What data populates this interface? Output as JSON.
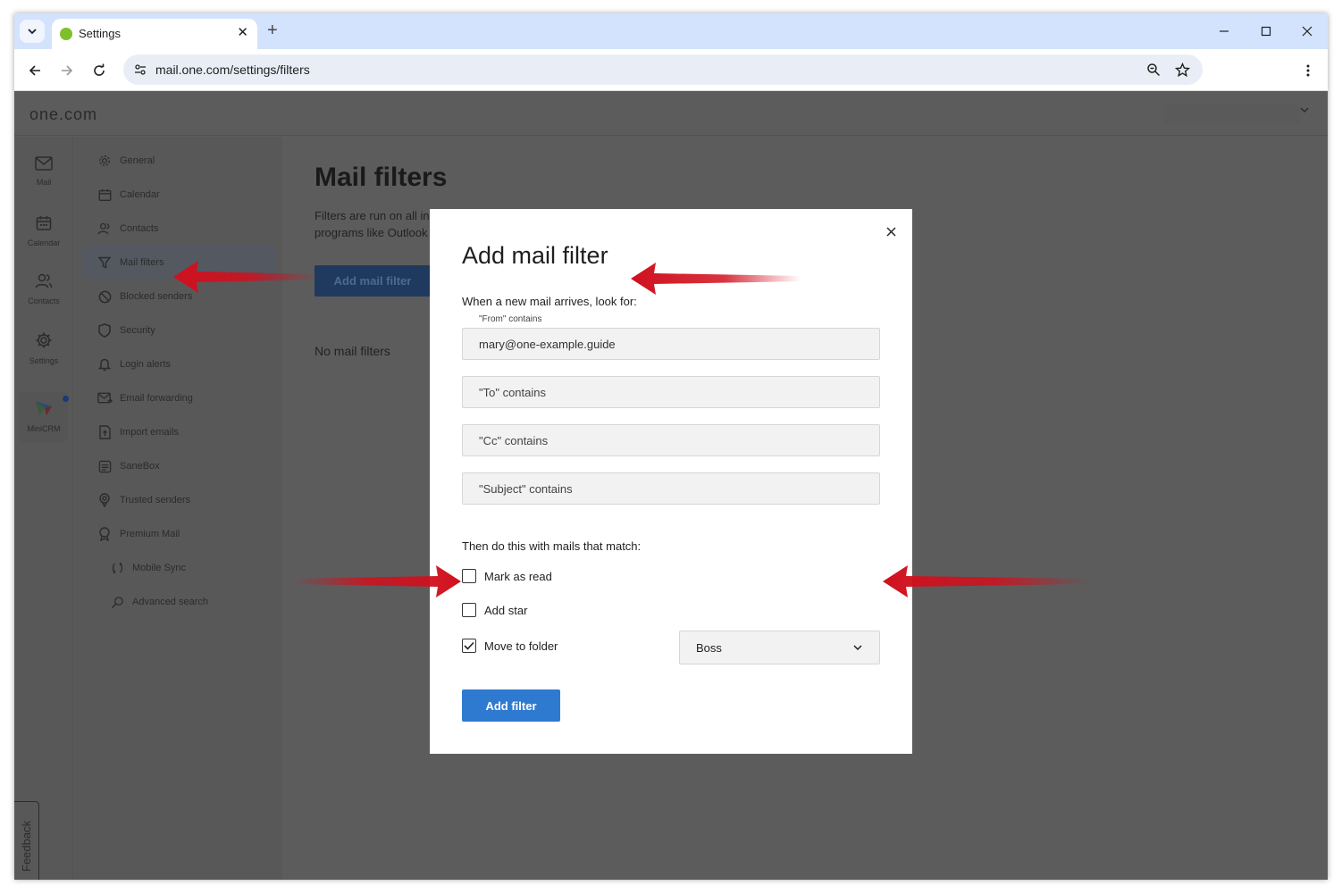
{
  "browser": {
    "tab_title": "Settings",
    "url": "mail.one.com/settings/filters"
  },
  "app": {
    "brand": "one.com",
    "rail": [
      {
        "label": "Mail",
        "icon": "mail-icon"
      },
      {
        "label": "Calendar",
        "icon": "calendar-icon"
      },
      {
        "label": "Contacts",
        "icon": "contacts-icon"
      },
      {
        "label": "Settings",
        "icon": "gear-icon"
      },
      {
        "label": "MiniCRM",
        "icon": "minicrm-logo-icon"
      }
    ],
    "feedback_label": "Feedback"
  },
  "settings_nav": [
    {
      "label": "General",
      "icon": "gear-icon"
    },
    {
      "label": "Calendar",
      "icon": "calendar-icon"
    },
    {
      "label": "Contacts",
      "icon": "contacts-icon"
    },
    {
      "label": "Mail filters",
      "icon": "filter-icon",
      "active": true
    },
    {
      "label": "Blocked senders",
      "icon": "block-icon"
    },
    {
      "label": "Security",
      "icon": "shield-icon"
    },
    {
      "label": "Login alerts",
      "icon": "bell-icon"
    },
    {
      "label": "Email forwarding",
      "icon": "forward-mail-icon"
    },
    {
      "label": "Import emails",
      "icon": "import-icon"
    },
    {
      "label": "SaneBox",
      "icon": "sanebox-icon"
    },
    {
      "label": "Trusted senders",
      "icon": "trusted-icon"
    },
    {
      "label": "Premium Mail",
      "icon": "badge-icon"
    },
    {
      "label": "Mobile Sync",
      "icon": "sync-icon"
    },
    {
      "label": "Advanced search",
      "icon": "search-icon"
    }
  ],
  "main": {
    "title": "Mail filters",
    "description_line1": "Filters are run on all inc",
    "description_line2": "programs like Outlook",
    "add_button": "Add mail filter",
    "empty_text": "No mail filters"
  },
  "modal": {
    "title": "Add mail filter",
    "subtitle": "When a new mail arrives, look for:",
    "from_label": "\"From\" contains",
    "from_value": "mary@one-example.guide",
    "to_placeholder": "\"To\" contains",
    "cc_placeholder": "\"Cc\" contains",
    "subject_placeholder": "\"Subject\" contains",
    "actions_title": "Then do this with mails that match:",
    "actions": [
      {
        "label": "Mark as read",
        "checked": false
      },
      {
        "label": "Add star",
        "checked": false
      },
      {
        "label": "Move to folder",
        "checked": true
      }
    ],
    "folder_selected": "Boss",
    "submit_label": "Add filter"
  },
  "colors": {
    "accent": "#2f7ad1",
    "overlay": "#5c5c5c",
    "annotation_arrow": "#d0101e"
  }
}
